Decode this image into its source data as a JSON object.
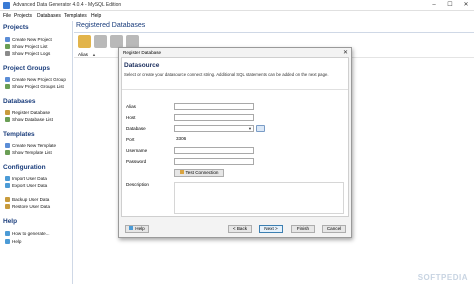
{
  "window": {
    "title": "Advanced Data Generator 4.0.4 - MySQL Edition",
    "controls": [
      "–",
      "☐",
      "✕"
    ]
  },
  "menu": [
    "File",
    "Projects",
    "Databases",
    "Templates",
    "Help"
  ],
  "sidebar": {
    "sections": [
      {
        "title": "Projects",
        "items": [
          "Create New Project",
          "Show Project List",
          "Show Project Logs"
        ]
      },
      {
        "title": "Project Groups",
        "items": [
          "Create New Project Group",
          "Show Project Groups List"
        ]
      },
      {
        "title": "Databases",
        "items": [
          "Register Database",
          "Show Database List"
        ]
      },
      {
        "title": "Templates",
        "items": [
          "Create  New Template",
          "Show Template List"
        ]
      },
      {
        "title": "Configuration",
        "items": [
          "Import User Data",
          "Export User Data",
          "Backup User Data",
          "Restore User Data"
        ]
      },
      {
        "title": "Help",
        "items": [
          "How to generate...",
          "Help"
        ]
      }
    ]
  },
  "main": {
    "title": "Registered Databases",
    "column_alias": "Alias",
    "sort_indicator": "▲"
  },
  "dialog": {
    "title": "Register Database",
    "heading": "Datasource",
    "subtitle": "Select or create your datasource connect string. Additional SQL statements can be added on the next page.",
    "fields": {
      "alias_label": "Alias",
      "alias_value": "",
      "host_label": "Host",
      "host_value": "",
      "database_label": "Database",
      "database_value": "",
      "port_label": "Port",
      "port_value": "3306",
      "username_label": "Username",
      "username_value": "",
      "password_label": "Password",
      "password_value": "",
      "description_label": "Description"
    },
    "test_connection": "Test Connection",
    "buttons": {
      "help": "Help",
      "back": "< Back",
      "next": "Next >",
      "finish": "Finish",
      "cancel": "Cancel"
    }
  },
  "watermark": "SOFTPEDIA",
  "colors": {
    "section_heading": "#1a3d7c",
    "dialog_heading": "#1a2d5c",
    "primary_button_border": "#3c7fb1"
  }
}
